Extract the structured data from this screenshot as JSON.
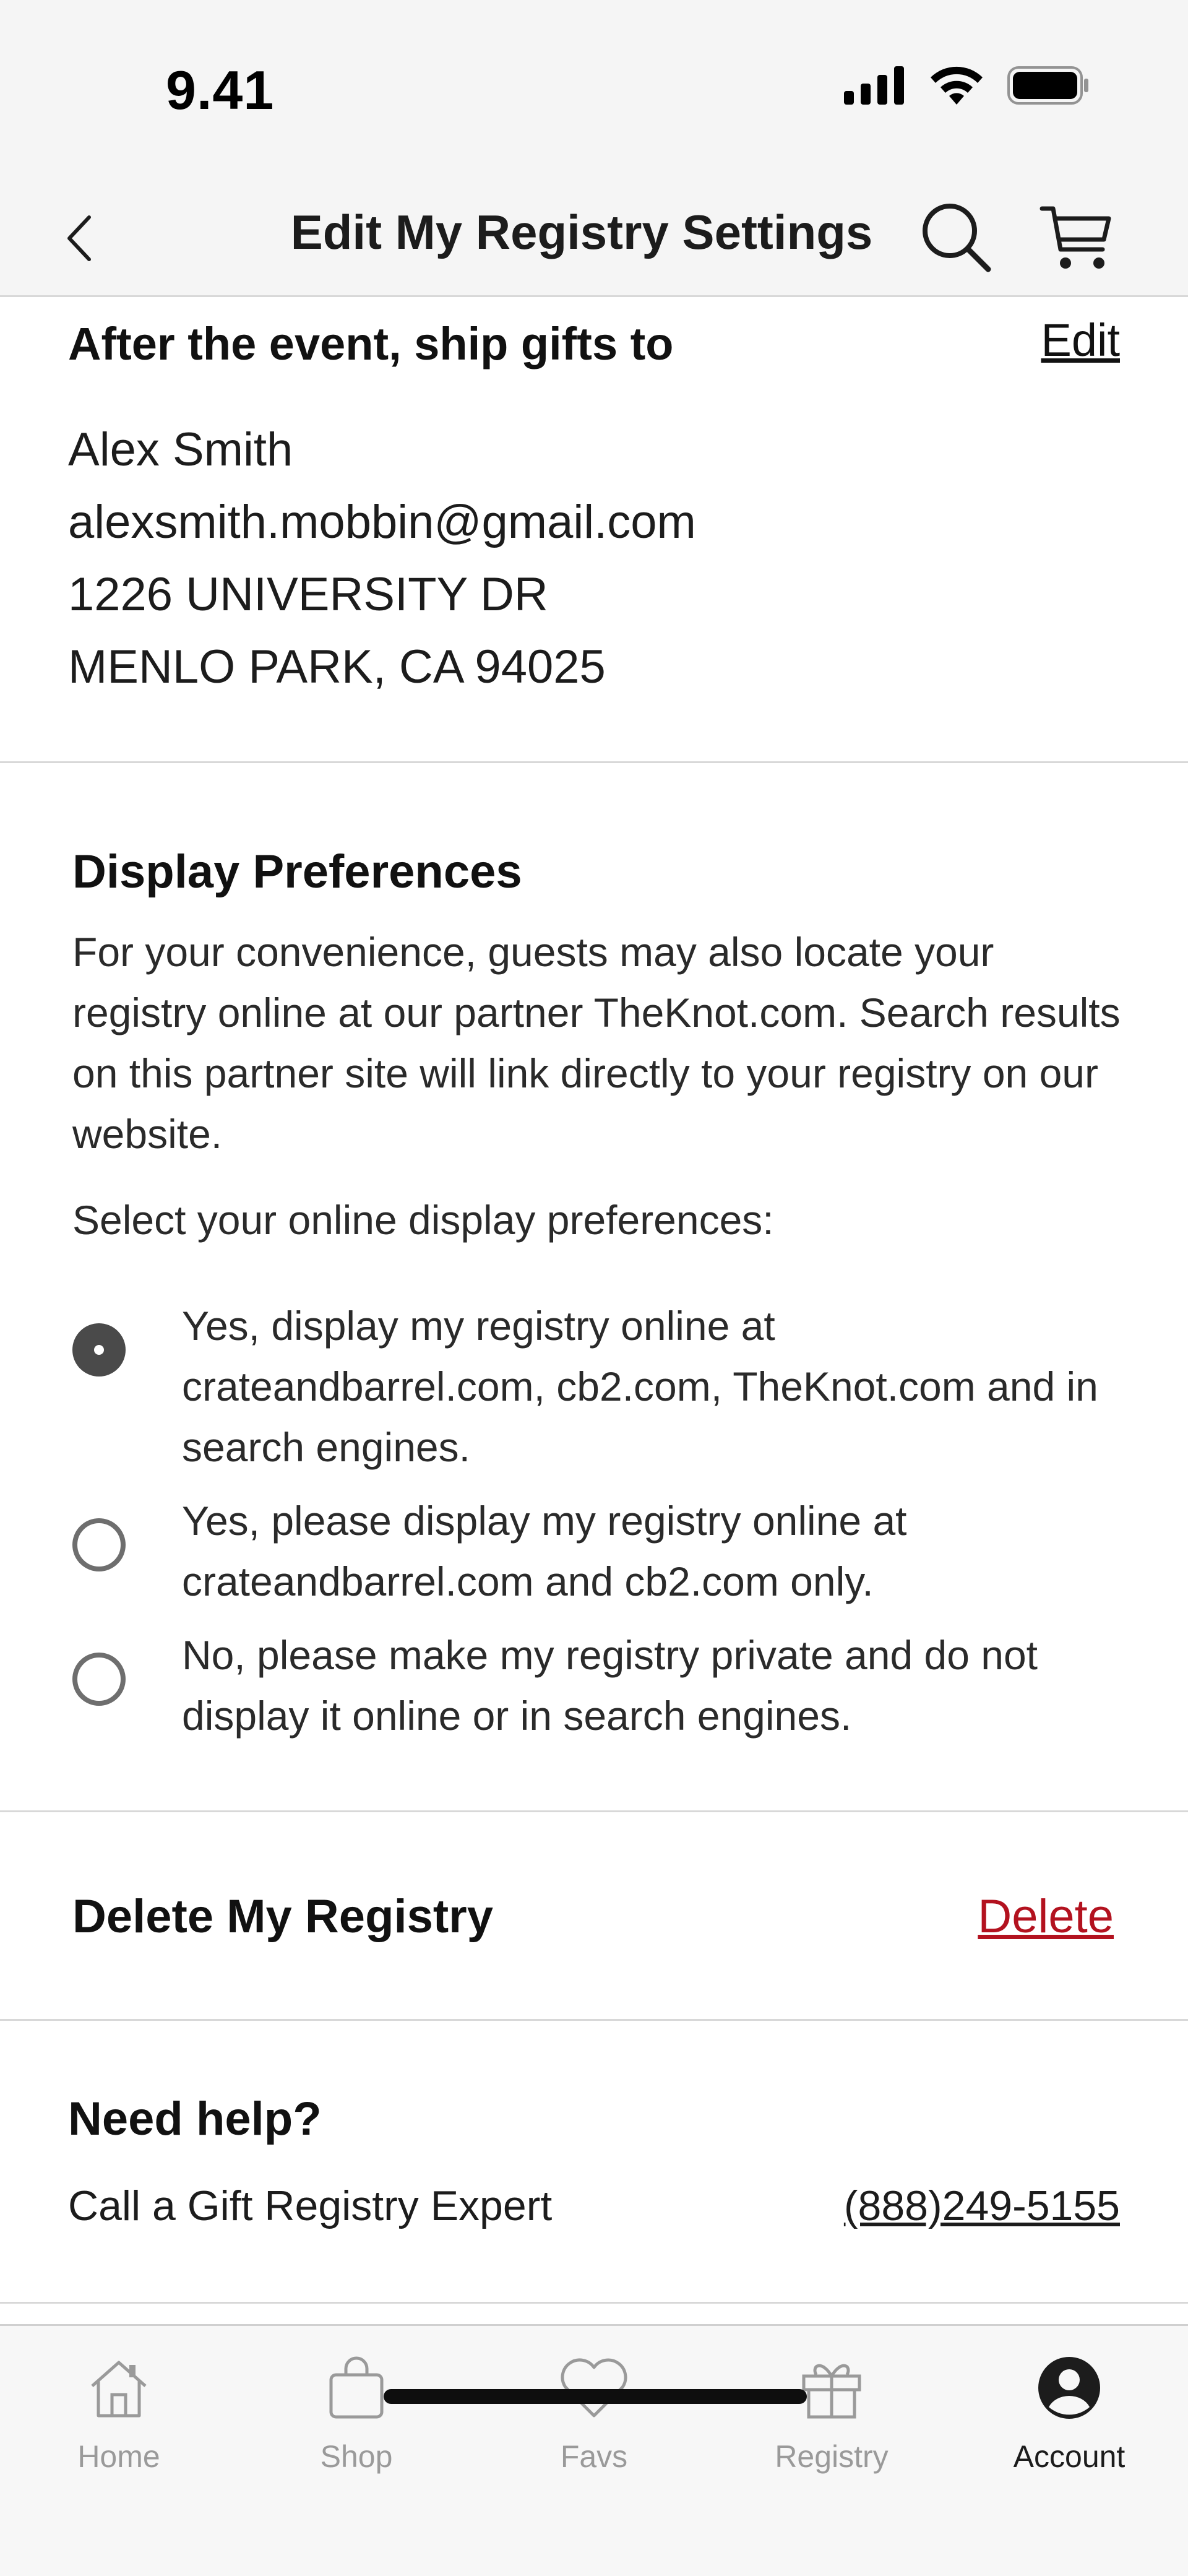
{
  "status_bar": {
    "time": "9.41"
  },
  "nav": {
    "title": "Edit My Registry Settings"
  },
  "ship_after_event": {
    "heading": "After the event, ship gifts to",
    "edit_label": "Edit",
    "name": "Alex Smith",
    "email": "alexsmith.mobbin@gmail.com",
    "address_line1": "1226 UNIVERSITY DR",
    "address_line2": "MENLO PARK, CA 94025"
  },
  "display_preferences": {
    "title": "Display Preferences",
    "description": "For your convenience, guests may also locate your registry online at our partner TheKnot.com. Search results on this partner site will link directly to your registry on our website.",
    "select_prompt": "Select your online display preferences:",
    "options": [
      {
        "label": "Yes, display my registry online at crateandbarrel.com, cb2.com, TheKnot.com and in search engines.",
        "selected": true
      },
      {
        "label": "Yes, please display my registry online at crateandbarrel.com and cb2.com only.",
        "selected": false
      },
      {
        "label": "No, please make my registry private and do not display it online or in search engines.",
        "selected": false
      }
    ]
  },
  "delete_registry": {
    "title": "Delete My Registry",
    "action_label": "Delete",
    "action_color": "#b3121f"
  },
  "help": {
    "title": "Need help?",
    "expert_label": "Call a Gift Registry Expert",
    "phone": "(888)249-5155"
  },
  "tab_bar": {
    "tabs": [
      {
        "label": "Home",
        "icon": "home-icon",
        "active": false
      },
      {
        "label": "Shop",
        "icon": "shopping-bag-icon",
        "active": false
      },
      {
        "label": "Favs",
        "icon": "heart-icon",
        "active": false
      },
      {
        "label": "Registry",
        "icon": "gift-icon",
        "active": false
      },
      {
        "label": "Account",
        "icon": "account-icon",
        "active": true
      }
    ]
  }
}
